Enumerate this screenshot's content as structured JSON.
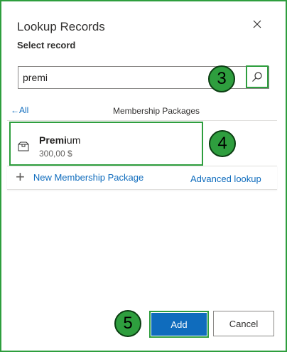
{
  "dialog": {
    "title": "Lookup Records",
    "subtitle": "Select record",
    "close_icon": "close-icon"
  },
  "search": {
    "value": "premi",
    "search_icon": "search-icon"
  },
  "list": {
    "back_label": "All",
    "header": "Membership Packages",
    "results": [
      {
        "name_match": "Premi",
        "name_rest": "um",
        "price": "300,00 $",
        "icon": "package-icon"
      }
    ]
  },
  "actions": {
    "new_label": "New Membership Package",
    "advanced_label": "Advanced lookup",
    "add_label": "Add",
    "cancel_label": "Cancel"
  },
  "steps": [
    "3",
    "4",
    "5"
  ],
  "colors": {
    "highlight": "#2e9e3e",
    "primary": "#0f6cbd"
  }
}
